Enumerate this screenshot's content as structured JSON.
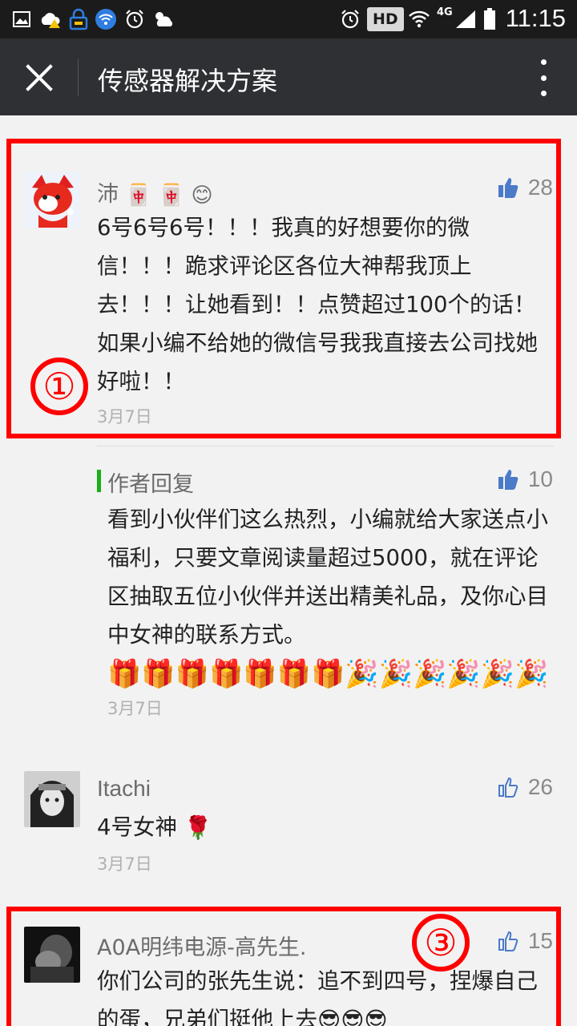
{
  "status_bar": {
    "hd": "HD",
    "network": "4G",
    "time": "11:15"
  },
  "app_bar": {
    "title": "传感器解决方案"
  },
  "comments": [
    {
      "nickname": "沛",
      "nickname_emojis": [
        "🀄",
        "🀄",
        "😊"
      ],
      "likes": "28",
      "text": "6号6号6号！！！我真的好想要你的微信！！！跪求评论区各位大神帮我顶上去！！！让她看到！！点赞超过100个的话！如果小编不给她的微信号我我直接去公司找她好啦！！",
      "date": "3月7日",
      "annotation": "①"
    },
    {
      "reply_title": "作者回复",
      "likes": "10",
      "text": "看到小伙伴们这么热烈，小编就给大家送点小福利，只要文章阅读量超过5000，就在评论区抽取五位小伙伴并送出精美礼品，及你心目中女神的联系方式。",
      "emojis": "🎁🎁🎁🎁🎁🎁🎁🎉🎉🎉🎉🎉🎉",
      "date": "3月7日"
    },
    {
      "nickname": "Itachi",
      "likes": "26",
      "text": "4号女神",
      "text_emoji": "🌹",
      "date": "3月7日"
    },
    {
      "nickname": "A0A明纬电源-高先生.",
      "likes": "15",
      "text": "你们公司的张先生说：追不到四号，捏爆自己的蛋，兄弟们挺他上去",
      "text_emojis": "😎😎😎",
      "annotation": "③"
    }
  ],
  "colors": {
    "status_bar_bg": "#1b1b1b",
    "app_bar_bg": "#2e3034",
    "page_bg": "#f2f2f2",
    "annotation_red": "#ff0000",
    "reply_accent": "#1aad19"
  }
}
